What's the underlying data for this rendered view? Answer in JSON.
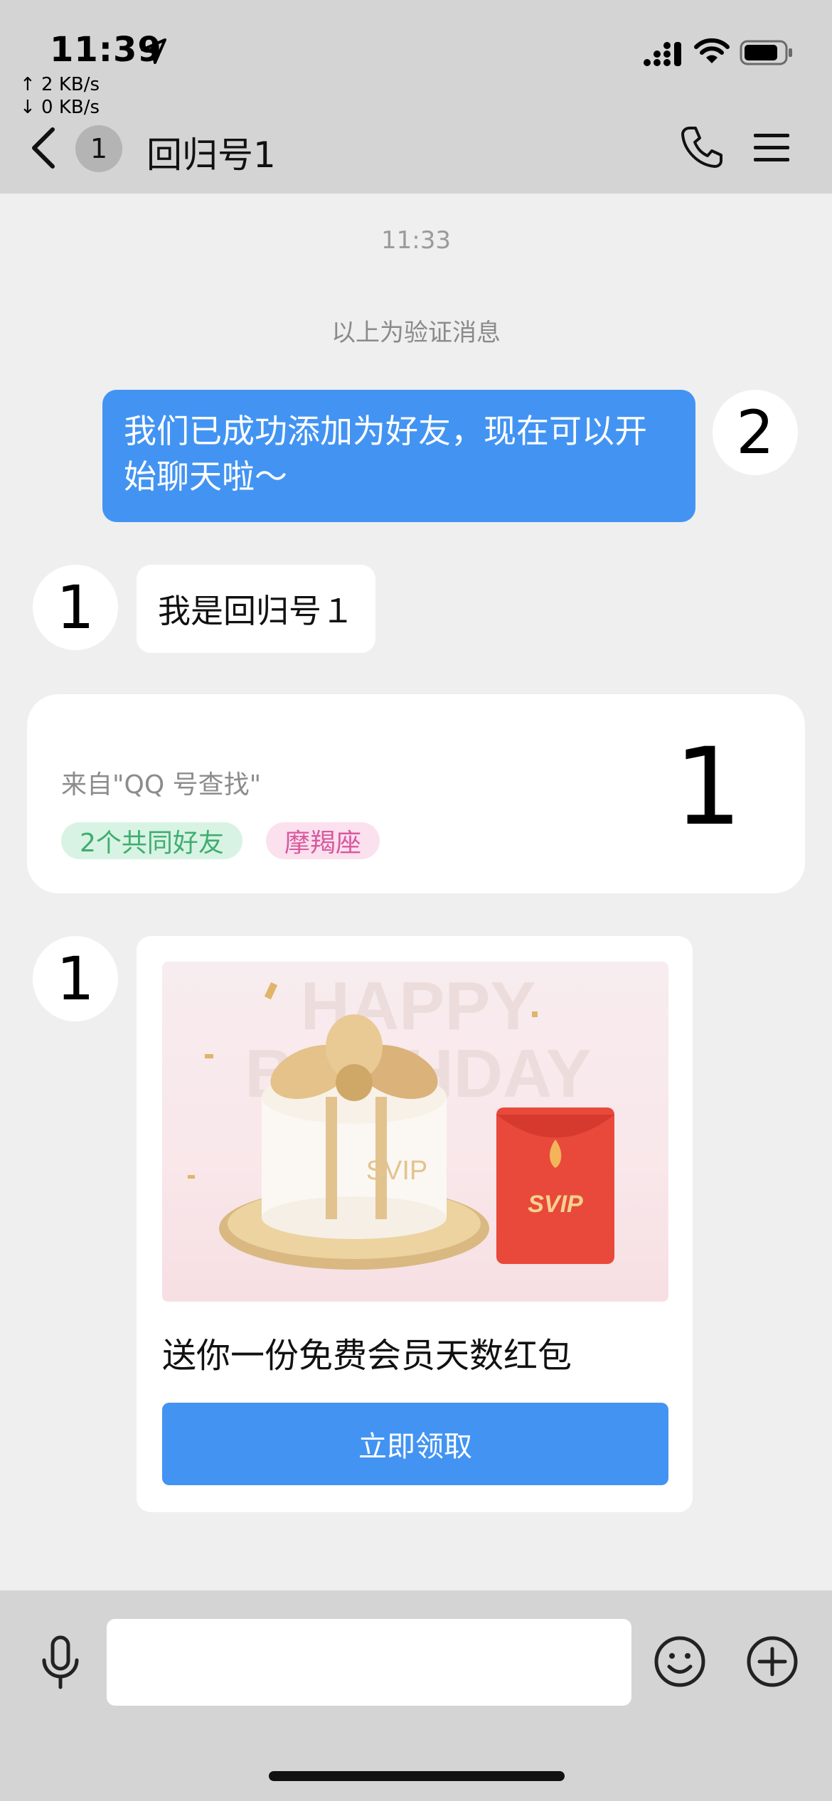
{
  "status": {
    "time": "11:39",
    "net_up": "↑ 2 KB/s",
    "net_down": "↓ 0 KB/s",
    "icons": [
      "location-arrow-icon",
      "signal-icon",
      "wifi-icon",
      "battery-icon"
    ]
  },
  "nav": {
    "unread_count": "1",
    "title": "回归号1",
    "icons": [
      "back-icon",
      "phone-icon",
      "menu-icon"
    ]
  },
  "chat": {
    "timestamp": "11:33",
    "system_message": "以上为验证消息",
    "outgoing": {
      "avatar_label": "2",
      "text": "我们已成功添加为好友，现在可以开始聊天啦～"
    },
    "incoming": {
      "avatar_label": "1",
      "text": "我是回归号１"
    },
    "profile_card": {
      "source": "来自\"QQ 号查找\"",
      "tags": [
        "2个共同好友",
        "摩羯座"
      ],
      "number": "1"
    },
    "gift_card": {
      "avatar_label": "1",
      "image_texts": [
        "HAPPY",
        "BIRTHDAY",
        "SVIP",
        "SVIP"
      ],
      "title": "送你一份免费会员天数红包",
      "button_label": "立即领取"
    }
  },
  "input_bar": {
    "placeholder": "",
    "icons": [
      "microphone-icon",
      "emoji-icon",
      "plus-icon"
    ]
  },
  "colors": {
    "accent": "#4394f2",
    "top_bar": "#d4d4d4",
    "chat_bg": "#efefef",
    "tag_green": "#3fae6f",
    "tag_pink": "#d9589e"
  }
}
